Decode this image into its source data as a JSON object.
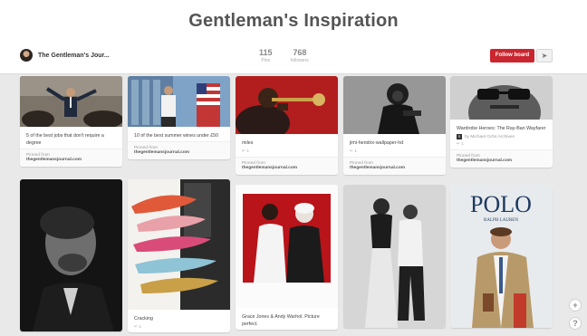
{
  "board": {
    "title": "Gentleman's Inspiration",
    "owner_name": "The Gentleman's Jour...",
    "pins_count": "115",
    "pins_label": "Pins",
    "followers_count": "768",
    "followers_label": "followers",
    "follow_label": "Follow board",
    "send_icon": "send-icon"
  },
  "pins": [
    {
      "description": "5 of the best jobs that don't require a degree",
      "foot_label": "Pinned from",
      "foot_source": "thegentlemansjournal.com"
    },
    {
      "description": "10 of the best summer wines under £50",
      "foot_label": "Pinned from",
      "foot_source": "thegentlemansjournal.com"
    },
    {
      "description": "miles",
      "meta": "1",
      "foot_label": "Pinned from",
      "foot_source": "thegentlemansjournal.com"
    },
    {
      "description": "jimi-hendrix-wallpaper-hd",
      "meta": "1",
      "foot_label": "Pinned from",
      "foot_source": "thegentlemansjournal.com"
    },
    {
      "description": "Wardrobe Heroes: The Ray-Ban Wayfarer",
      "attribution": "by Michael Ochs Archives",
      "attribution_icon": "source-logo-icon",
      "meta": "1",
      "foot_label": "Pinned from",
      "foot_source": "thegentlemansjournal.com"
    },
    {
      "description": ""
    },
    {
      "description": "Cracking",
      "meta": "1"
    },
    {
      "description": "Grace Jones & Andy Warhol. Picture perfect."
    },
    {
      "description": ""
    },
    {
      "description": ""
    }
  ],
  "images": {
    "poster_brand": "POLO",
    "poster_sub": "RALPH LAUREN"
  },
  "controls": {
    "add_icon": "+",
    "help_icon": "?"
  }
}
